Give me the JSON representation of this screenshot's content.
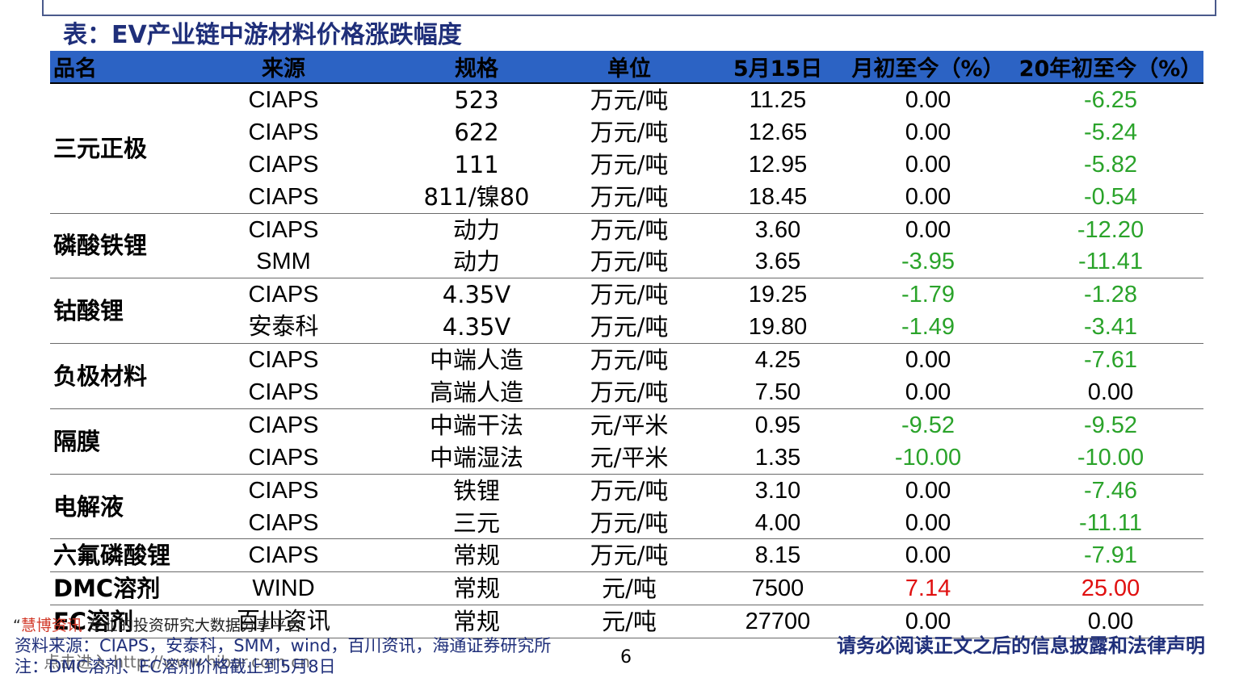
{
  "page": {
    "title": "表：EV产业链中游材料价格涨跌幅度",
    "page_number": "6",
    "source_note": "资料来源：CIAPS，安泰科，SMM，wind，百川资讯，海通证券研究所",
    "note": "注：DMC溶剂、EC溶剂价格截止到5月8日",
    "disclaimer": "请务必阅读正文之后的信息披露和法律声明",
    "watermark_quote": "“",
    "watermark_brand": "慧博资讯",
    "watermark_text": "专业的投资研究大数据分享平台",
    "watermark_link": "点击进入 http://www.hibor.com.cn"
  },
  "table": {
    "headers": [
      "品名",
      "来源",
      "规格",
      "单位",
      "5月15日",
      "月初至今（%）",
      "20年初至今（%）"
    ],
    "groups": [
      {
        "name": "三元正极",
        "rows": [
          {
            "source": "CIAPS",
            "spec": "523",
            "unit": "万元/吨",
            "price": "11.25",
            "mtd": "0.00",
            "ytd": "-6.25"
          },
          {
            "source": "CIAPS",
            "spec": "622",
            "unit": "万元/吨",
            "price": "12.65",
            "mtd": "0.00",
            "ytd": "-5.24"
          },
          {
            "source": "CIAPS",
            "spec": "111",
            "unit": "万元/吨",
            "price": "12.95",
            "mtd": "0.00",
            "ytd": "-5.82"
          },
          {
            "source": "CIAPS",
            "spec": "811/镍80",
            "unit": "万元/吨",
            "price": "18.45",
            "mtd": "0.00",
            "ytd": "-0.54"
          }
        ]
      },
      {
        "name": "磷酸铁锂",
        "rows": [
          {
            "source": "CIAPS",
            "spec": "动力",
            "unit": "万元/吨",
            "price": "3.60",
            "mtd": "0.00",
            "ytd": "-12.20"
          },
          {
            "source": "SMM",
            "spec": "动力",
            "unit": "万元/吨",
            "price": "3.65",
            "mtd": "-3.95",
            "ytd": "-11.41"
          }
        ]
      },
      {
        "name": "钴酸锂",
        "rows": [
          {
            "source": "CIAPS",
            "spec": "4.35V",
            "unit": "万元/吨",
            "price": "19.25",
            "mtd": "-1.79",
            "ytd": "-1.28"
          },
          {
            "source": "安泰科",
            "spec": "4.35V",
            "unit": "万元/吨",
            "price": "19.80",
            "mtd": "-1.49",
            "ytd": "-3.41"
          }
        ]
      },
      {
        "name": "负极材料",
        "rows": [
          {
            "source": "CIAPS",
            "spec": "中端人造",
            "unit": "万元/吨",
            "price": "4.25",
            "mtd": "0.00",
            "ytd": "-7.61"
          },
          {
            "source": "CIAPS",
            "spec": "高端人造",
            "unit": "万元/吨",
            "price": "7.50",
            "mtd": "0.00",
            "ytd": "0.00"
          }
        ]
      },
      {
        "name": "隔膜",
        "rows": [
          {
            "source": "CIAPS",
            "spec": "中端干法",
            "unit": "元/平米",
            "price": "0.95",
            "mtd": "-9.52",
            "ytd": "-9.52"
          },
          {
            "source": "CIAPS",
            "spec": "中端湿法",
            "unit": "元/平米",
            "price": "1.35",
            "mtd": "-10.00",
            "ytd": "-10.00"
          }
        ]
      },
      {
        "name": "电解液",
        "rows": [
          {
            "source": "CIAPS",
            "spec": "铁锂",
            "unit": "万元/吨",
            "price": "3.10",
            "mtd": "0.00",
            "ytd": "-7.46"
          },
          {
            "source": "CIAPS",
            "spec": "三元",
            "unit": "万元/吨",
            "price": "4.00",
            "mtd": "0.00",
            "ytd": "-11.11"
          }
        ]
      },
      {
        "name": "六氟磷酸锂",
        "rows": [
          {
            "source": "CIAPS",
            "spec": "常规",
            "unit": "万元/吨",
            "price": "8.15",
            "mtd": "0.00",
            "ytd": "-7.91"
          }
        ]
      },
      {
        "name": "DMC溶剂",
        "rows": [
          {
            "source": "WIND",
            "spec": "常规",
            "unit": "元/吨",
            "price": "7500",
            "mtd": "7.14",
            "ytd": "25.00"
          }
        ]
      },
      {
        "name": "EC溶剂",
        "rows": [
          {
            "source": "百川资讯",
            "spec": "常规",
            "unit": "元/吨",
            "price": "27700",
            "mtd": "0.00",
            "ytd": "0.00"
          }
        ]
      }
    ]
  },
  "colors": {
    "header_bg": "#2c63c4",
    "title": "#1f2f7a",
    "negative": "#2aa32a",
    "positive": "#e01010"
  }
}
